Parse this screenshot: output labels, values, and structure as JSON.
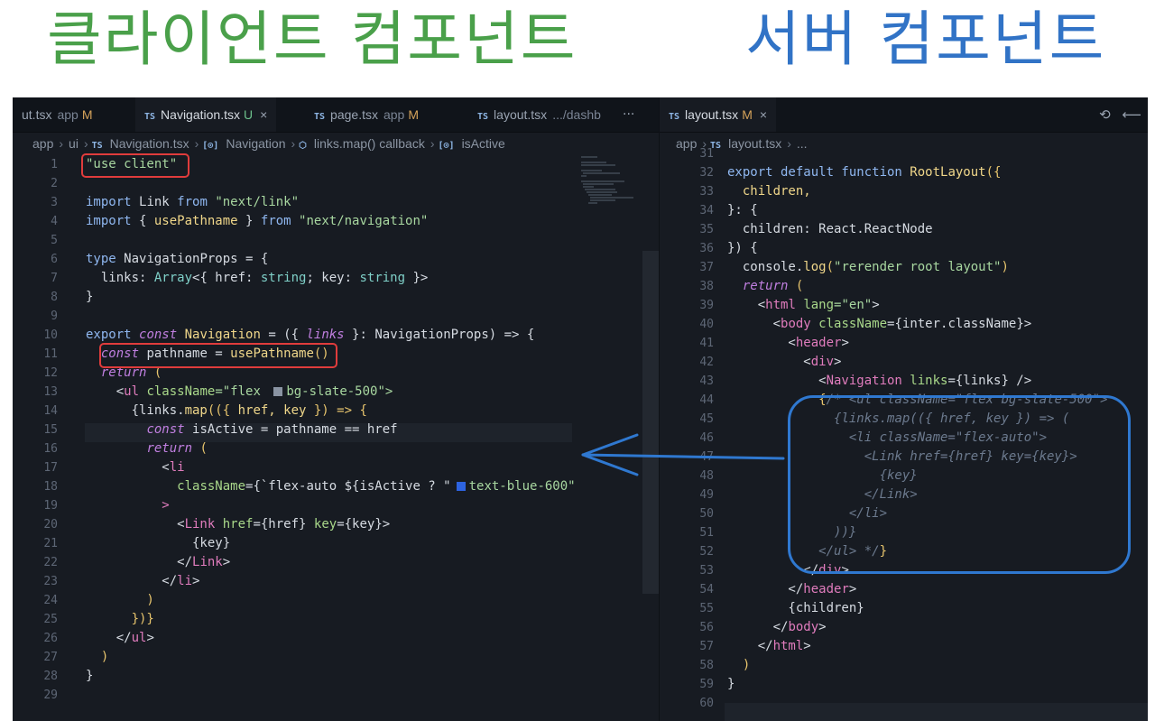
{
  "headings": {
    "client": "클라이언트 컴포넌트",
    "server": "서버 컴포넌트"
  },
  "left_pane": {
    "tabs": [
      {
        "label": "ut.tsx",
        "sub": "app",
        "status": "M",
        "has_icon": false
      },
      {
        "label": "Navigation.tsx",
        "sub": "",
        "status": "U",
        "has_icon": true,
        "close": "×"
      },
      {
        "label": "page.tsx",
        "sub": "app",
        "status": "M",
        "has_icon": true
      },
      {
        "label": "layout.tsx",
        "sub": ".../dashb",
        "status": "",
        "has_icon": true
      }
    ],
    "ts_badge": "TS",
    "more": "···",
    "breadcrumb": [
      "app",
      "ui",
      "Navigation.tsx",
      "Navigation",
      "links.map() callback",
      "isActive"
    ],
    "line_numbers": [
      "1",
      "2",
      "3",
      "4",
      "5",
      "6",
      "7",
      "8",
      "9",
      "10",
      "11",
      "12",
      "13",
      "14",
      "15",
      "16",
      "17",
      "18",
      "19",
      "20",
      "21",
      "22",
      "23",
      "24",
      "25",
      "26",
      "27",
      "28",
      "29"
    ],
    "lines": [
      [
        {
          "t": "\"use client\"",
          "c": "str"
        }
      ],
      [],
      [
        {
          "t": "import ",
          "c": "kw"
        },
        {
          "t": "Link ",
          "c": ""
        },
        {
          "t": "from ",
          "c": "kw"
        },
        {
          "t": "\"next/link\"",
          "c": "str"
        }
      ],
      [
        {
          "t": "import ",
          "c": "kw"
        },
        {
          "t": "{ ",
          "c": ""
        },
        {
          "t": "usePathname",
          "c": "fn"
        },
        {
          "t": " } ",
          "c": ""
        },
        {
          "t": "from ",
          "c": "kw"
        },
        {
          "t": "\"next/navigation\"",
          "c": "str"
        }
      ],
      [],
      [
        {
          "t": "type ",
          "c": "kw"
        },
        {
          "t": "NavigationProps = {",
          "c": ""
        }
      ],
      [
        {
          "t": "  links: ",
          "c": ""
        },
        {
          "t": "Array",
          "c": "ty"
        },
        {
          "t": "<{ href: ",
          "c": ""
        },
        {
          "t": "string",
          "c": "ty"
        },
        {
          "t": "; key: ",
          "c": ""
        },
        {
          "t": "string",
          "c": "ty"
        },
        {
          "t": " }>",
          "c": ""
        }
      ],
      [
        {
          "t": "}",
          "c": ""
        }
      ],
      [],
      [
        {
          "t": "export ",
          "c": "kw"
        },
        {
          "t": "const ",
          "c": "it"
        },
        {
          "t": "Navigation",
          "c": "fn"
        },
        {
          "t": " = ({ ",
          "c": ""
        },
        {
          "t": "links",
          "c": "it"
        },
        {
          "t": " }: NavigationProps) => {",
          "c": ""
        }
      ],
      [
        {
          "t": "  ",
          "c": ""
        },
        {
          "t": "const ",
          "c": "it"
        },
        {
          "t": "pathname = ",
          "c": ""
        },
        {
          "t": "usePathname",
          "c": "fn"
        },
        {
          "t": "()",
          "c": "br"
        }
      ],
      [
        {
          "t": "  ",
          "c": ""
        },
        {
          "t": "return ",
          "c": "it"
        },
        {
          "t": "(",
          "c": "br"
        }
      ],
      [
        {
          "t": "    <",
          "c": ""
        },
        {
          "t": "ul ",
          "c": "tag"
        },
        {
          "t": "className",
          "c": "attr"
        },
        {
          "t": "=\"flex ",
          "c": "str"
        },
        {
          "t": "SWATCH_GRAY",
          "c": "swatch"
        },
        {
          "t": "bg-slate-500\">",
          "c": "str"
        }
      ],
      [
        {
          "t": "      {links.",
          "c": ""
        },
        {
          "t": "map",
          "c": "fn"
        },
        {
          "t": "(({ ",
          "c": "br"
        },
        {
          "t": "href, key",
          "c": "fn"
        },
        {
          "t": " }) => {",
          "c": "br"
        }
      ],
      [
        {
          "t": "        ",
          "c": ""
        },
        {
          "t": "const ",
          "c": "it"
        },
        {
          "t": "isActive = pathname == href",
          "c": ""
        }
      ],
      [
        {
          "t": "        ",
          "c": ""
        },
        {
          "t": "return ",
          "c": "it"
        },
        {
          "t": "(",
          "c": "br"
        }
      ],
      [
        {
          "t": "          <",
          "c": ""
        },
        {
          "t": "li",
          "c": "tag"
        }
      ],
      [
        {
          "t": "            ",
          "c": ""
        },
        {
          "t": "className",
          "c": "attr"
        },
        {
          "t": "={`flex-auto ${isActive ? \"",
          "c": ""
        },
        {
          "t": "SWATCH_BLUE",
          "c": "swatch"
        },
        {
          "t": "text-blue-600\"",
          "c": "str"
        }
      ],
      [
        {
          "t": "          >",
          "c": "tag"
        }
      ],
      [
        {
          "t": "            <",
          "c": ""
        },
        {
          "t": "Link ",
          "c": "tag"
        },
        {
          "t": "href",
          "c": "attr"
        },
        {
          "t": "={href} ",
          "c": ""
        },
        {
          "t": "key",
          "c": "attr"
        },
        {
          "t": "={key}>",
          "c": ""
        }
      ],
      [
        {
          "t": "              {key}",
          "c": ""
        }
      ],
      [
        {
          "t": "            </",
          "c": ""
        },
        {
          "t": "Link",
          "c": "tag"
        },
        {
          "t": ">",
          "c": ""
        }
      ],
      [
        {
          "t": "          </",
          "c": ""
        },
        {
          "t": "li",
          "c": "tag"
        },
        {
          "t": ">",
          "c": ""
        }
      ],
      [
        {
          "t": "        )",
          "c": "br"
        }
      ],
      [
        {
          "t": "      })}",
          "c": "br"
        }
      ],
      [
        {
          "t": "    </",
          "c": ""
        },
        {
          "t": "ul",
          "c": "tag"
        },
        {
          "t": ">",
          "c": ""
        }
      ],
      [
        {
          "t": "  )",
          "c": "br"
        }
      ],
      [
        {
          "t": "}",
          "c": ""
        }
      ],
      []
    ]
  },
  "right_pane": {
    "tab": {
      "label": "layout.tsx",
      "status": "M",
      "close": "×"
    },
    "ts_badge": "TS",
    "icons": [
      "⟲",
      "⟵"
    ],
    "breadcrumb": [
      "app",
      "layout.tsx",
      "..."
    ],
    "line_numbers": [
      "31",
      "32",
      "33",
      "34",
      "35",
      "36",
      "37",
      "38",
      "39",
      "40",
      "41",
      "42",
      "43",
      "44",
      "45",
      "46",
      "47",
      "48",
      "49",
      "50",
      "51",
      "52",
      "53",
      "54",
      "55",
      "56",
      "57",
      "58",
      "59",
      "60"
    ],
    "lines": [
      [],
      [
        {
          "t": "export default function ",
          "c": "kw"
        },
        {
          "t": "RootLayout",
          "c": "fn"
        },
        {
          "t": "({",
          "c": "br"
        }
      ],
      [
        {
          "t": "  children,",
          "c": "fn"
        }
      ],
      [
        {
          "t": "}: {",
          "c": ""
        }
      ],
      [
        {
          "t": "  children: React.ReactNode",
          "c": ""
        }
      ],
      [
        {
          "t": "}) {",
          "c": ""
        }
      ],
      [
        {
          "t": "  console.",
          "c": ""
        },
        {
          "t": "log",
          "c": "fn"
        },
        {
          "t": "(",
          "c": "br"
        },
        {
          "t": "\"rerender root layout\"",
          "c": "str"
        },
        {
          "t": ")",
          "c": "br"
        }
      ],
      [
        {
          "t": "  ",
          "c": ""
        },
        {
          "t": "return ",
          "c": "it"
        },
        {
          "t": "(",
          "c": "br"
        }
      ],
      [
        {
          "t": "    <",
          "c": ""
        },
        {
          "t": "html ",
          "c": "tag"
        },
        {
          "t": "lang",
          "c": "attr"
        },
        {
          "t": "=\"en\"",
          "c": "str"
        },
        {
          "t": ">",
          "c": ""
        }
      ],
      [
        {
          "t": "      <",
          "c": ""
        },
        {
          "t": "body ",
          "c": "tag"
        },
        {
          "t": "className",
          "c": "attr"
        },
        {
          "t": "={inter.className}>",
          "c": ""
        }
      ],
      [
        {
          "t": "        <",
          "c": ""
        },
        {
          "t": "header",
          "c": "tag"
        },
        {
          "t": ">",
          "c": ""
        }
      ],
      [
        {
          "t": "          <",
          "c": ""
        },
        {
          "t": "div",
          "c": "tag"
        },
        {
          "t": ">",
          "c": ""
        }
      ],
      [
        {
          "t": "            <",
          "c": ""
        },
        {
          "t": "Navigation ",
          "c": "tag"
        },
        {
          "t": "links",
          "c": "attr"
        },
        {
          "t": "={links} />",
          "c": ""
        }
      ],
      [
        {
          "t": "            {",
          "c": "br"
        },
        {
          "t": "/* <ul className=\"flex bg-slate-500\">",
          "c": "cm"
        }
      ],
      [
        {
          "t": "              ",
          "c": ""
        },
        {
          "t": "{links.map(({ href, key }) => (",
          "c": "cm"
        }
      ],
      [
        {
          "t": "                ",
          "c": ""
        },
        {
          "t": "<li className=\"flex-auto\">",
          "c": "cm"
        }
      ],
      [
        {
          "t": "                  ",
          "c": ""
        },
        {
          "t": "<Link href={href} key={key}>",
          "c": "cm"
        }
      ],
      [
        {
          "t": "                    ",
          "c": ""
        },
        {
          "t": "{key}",
          "c": "cm"
        }
      ],
      [
        {
          "t": "                  ",
          "c": ""
        },
        {
          "t": "</Link>",
          "c": "cm"
        }
      ],
      [
        {
          "t": "                ",
          "c": ""
        },
        {
          "t": "</li>",
          "c": "cm"
        }
      ],
      [
        {
          "t": "              ",
          "c": ""
        },
        {
          "t": "))}",
          "c": "cm"
        }
      ],
      [
        {
          "t": "            ",
          "c": ""
        },
        {
          "t": "</ul> */",
          "c": "cm"
        },
        {
          "t": "}",
          "c": "br"
        }
      ],
      [
        {
          "t": "          </",
          "c": ""
        },
        {
          "t": "div",
          "c": "tag"
        },
        {
          "t": ">",
          "c": ""
        }
      ],
      [
        {
          "t": "        </",
          "c": ""
        },
        {
          "t": "header",
          "c": "tag"
        },
        {
          "t": ">",
          "c": ""
        }
      ],
      [
        {
          "t": "        {children}",
          "c": ""
        }
      ],
      [
        {
          "t": "      </",
          "c": ""
        },
        {
          "t": "body",
          "c": "tag"
        },
        {
          "t": ">",
          "c": ""
        }
      ],
      [
        {
          "t": "    </",
          "c": ""
        },
        {
          "t": "html",
          "c": "tag"
        },
        {
          "t": ">",
          "c": ""
        }
      ],
      [
        {
          "t": "  )",
          "c": "br"
        }
      ],
      [
        {
          "t": "}",
          "c": ""
        }
      ],
      []
    ]
  },
  "colors": {
    "client_heading": "#4aa04a",
    "server_heading": "#3173c6",
    "highlight_box": "#e03c3c",
    "callout_box": "#2f78d0",
    "swatch_gray": "#8a94a3",
    "swatch_blue": "#2d63e0"
  }
}
